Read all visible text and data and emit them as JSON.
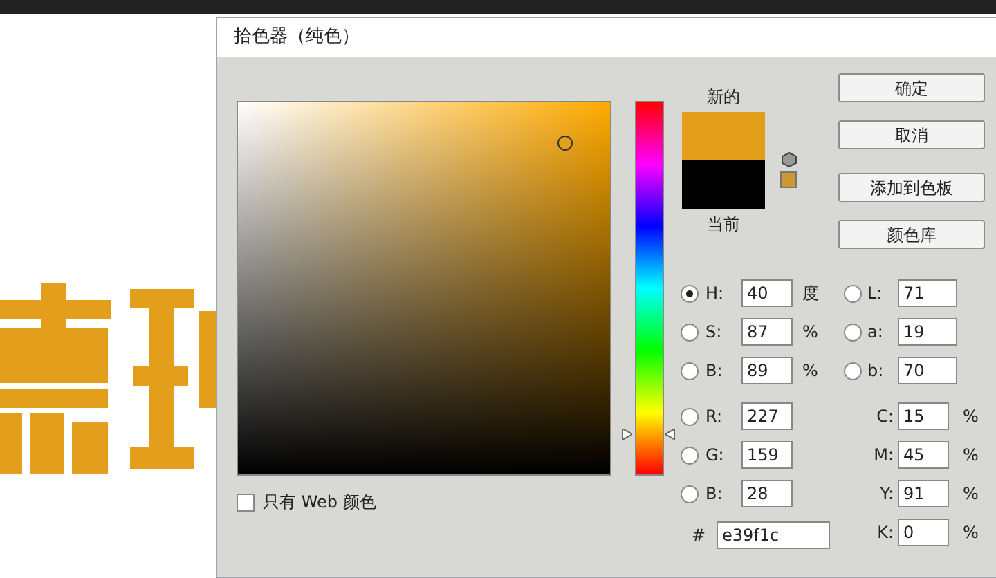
{
  "dialog": {
    "title": "拾色器（纯色）",
    "new_label": "新的",
    "current_label": "当前",
    "hue_slider": {
      "level": 0.11
    },
    "buttons": [
      {
        "label": "确定"
      },
      {
        "label": "取消"
      },
      {
        "label": "添加到色板"
      },
      {
        "label": "颜色库"
      }
    ],
    "web_only": {
      "label": "只有 Web 颜色",
      "checked": false
    },
    "hsb_fields": [
      {
        "label": "H:",
        "value": "40",
        "unit": "度",
        "selected": true
      },
      {
        "label": "S:",
        "value": "87",
        "unit": "%",
        "selected": false
      },
      {
        "label": "B:",
        "value": "89",
        "unit": "%",
        "selected": false
      }
    ],
    "rgb_fields": [
      {
        "label": "R:",
        "value": "227",
        "selected": false
      },
      {
        "label": "G:",
        "value": "159",
        "selected": false
      },
      {
        "label": "B:",
        "value": "28",
        "selected": false
      }
    ],
    "lab_fields": [
      {
        "label": "L:",
        "value": "71",
        "selected": false
      },
      {
        "label": "a:",
        "value": "19",
        "selected": false
      },
      {
        "label": "b:",
        "value": "70",
        "selected": false
      }
    ],
    "cmyk_fields": [
      {
        "label": "C:",
        "value": "15",
        "unit": "%"
      },
      {
        "label": "M:",
        "value": "45",
        "unit": "%"
      },
      {
        "label": "Y:",
        "value": "91",
        "unit": "%"
      },
      {
        "label": "K:",
        "value": "0",
        "unit": "%"
      }
    ],
    "hex": {
      "label": "#",
      "value": "e39f1c"
    }
  }
}
